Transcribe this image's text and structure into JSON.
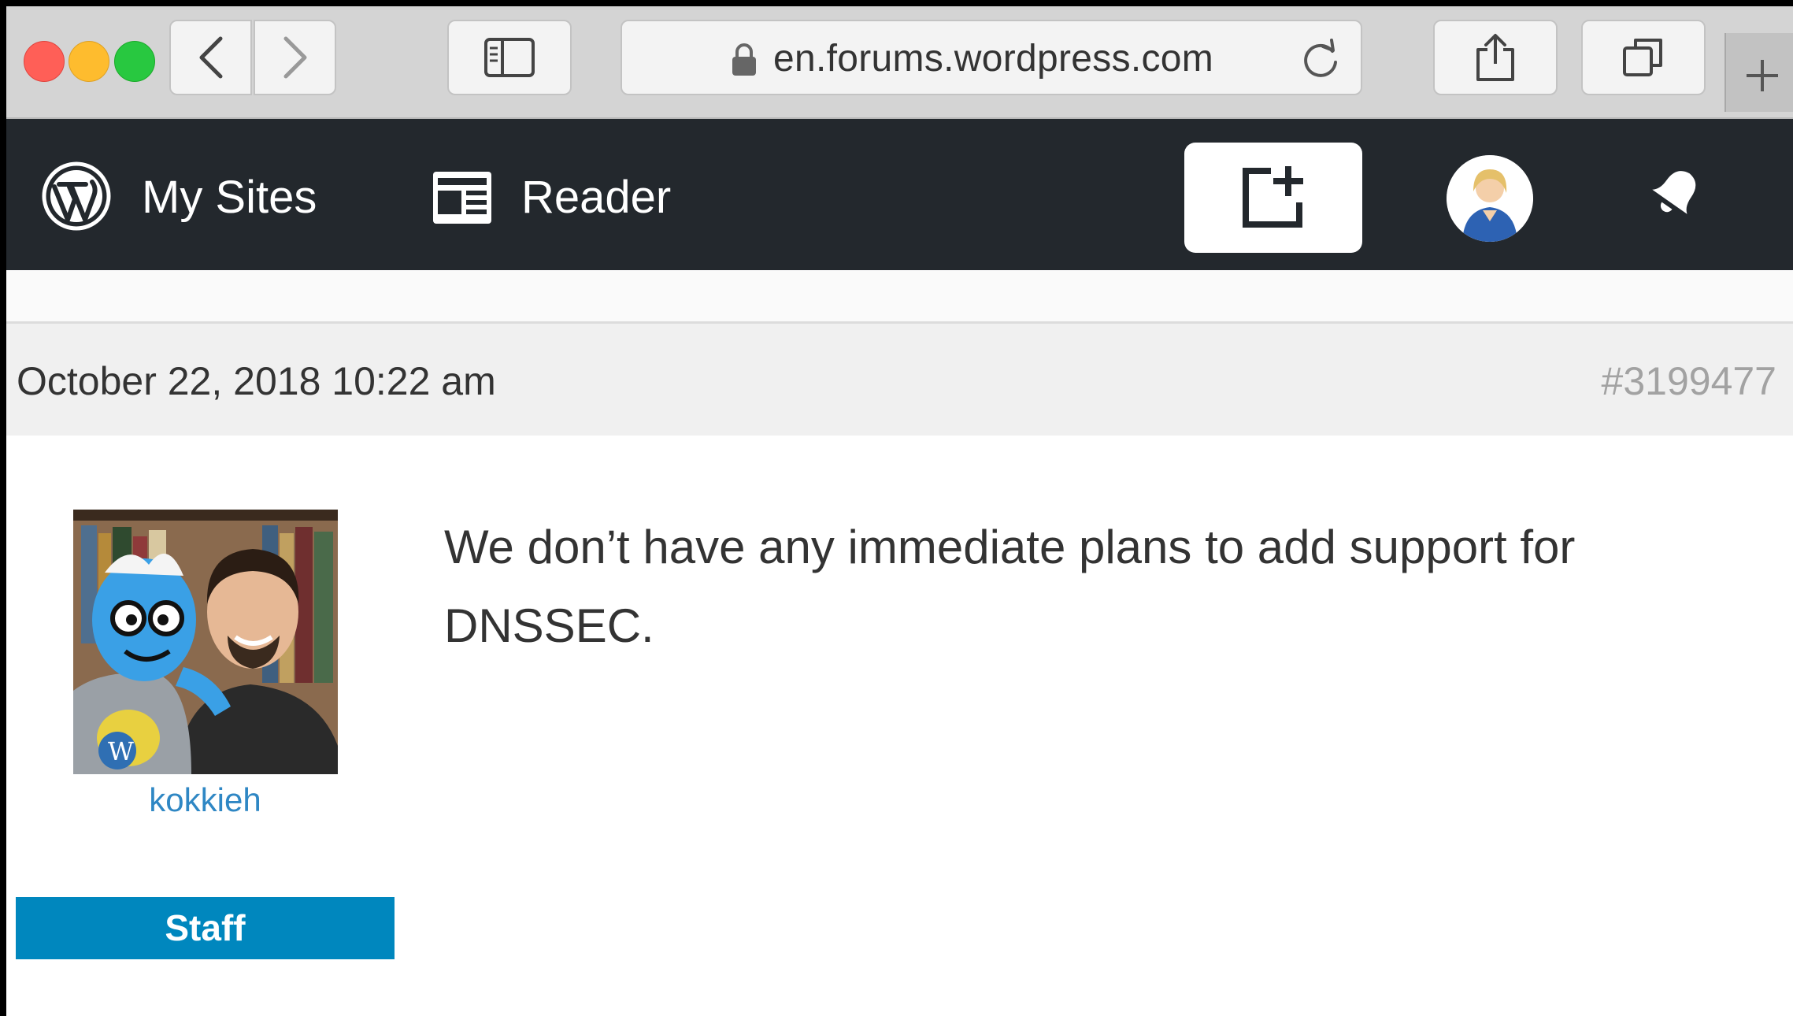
{
  "browser": {
    "url": "en.forums.wordpress.com"
  },
  "masterbar": {
    "my_sites_label": "My Sites",
    "reader_label": "Reader"
  },
  "post": {
    "date": "October 22, 2018 10:22 am",
    "id": "#3199477",
    "author": {
      "name": "kokkieh",
      "badge": "Staff"
    },
    "text": "We don’t have any immediate plans to add support for DNSSEC."
  },
  "colors": {
    "masterbar_bg": "#23282d",
    "author_link": "#2f87c4",
    "staff_badge": "#0087be",
    "traffic_red": "#ff5f57",
    "traffic_yellow": "#febc2e",
    "traffic_green": "#28c840"
  },
  "icons": {
    "lock": "lock-icon",
    "reload": "reload-icon",
    "share": "share-icon",
    "tabs": "tabs-icon",
    "sidebar": "sidebar-icon",
    "back": "chevron-left-icon",
    "forward": "chevron-right-icon",
    "new_tab": "plus-icon",
    "wordpress": "wordpress-logo-icon",
    "reader": "reader-icon",
    "write": "write-post-icon",
    "notifications": "bell-icon"
  }
}
